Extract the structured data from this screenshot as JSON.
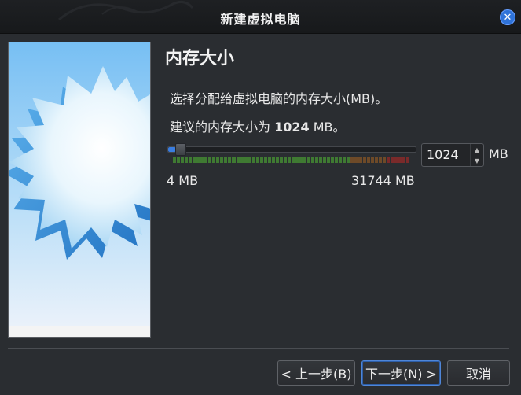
{
  "window": {
    "title": "新建虚拟电脑"
  },
  "page": {
    "heading": "内存大小",
    "description": "选择分配给虚拟电脑的内存大小(MB)。",
    "recommendation_prefix": "建议的内存大小为 ",
    "recommendation_value": "1024",
    "recommendation_suffix": " MB。"
  },
  "memory": {
    "value": "1024",
    "unit": "MB",
    "min_label": "4 MB",
    "max_label": "31744 MB",
    "slider_fraction": 0.032
  },
  "buttons": {
    "back": "< 上一步(B)",
    "next": "下一步(N) >",
    "cancel": "取消"
  },
  "colors": {
    "accent": "#2f73d9",
    "scale_green": "#3f7a32",
    "scale_brown": "#6e4a28",
    "scale_red": "#7a2a2a"
  }
}
